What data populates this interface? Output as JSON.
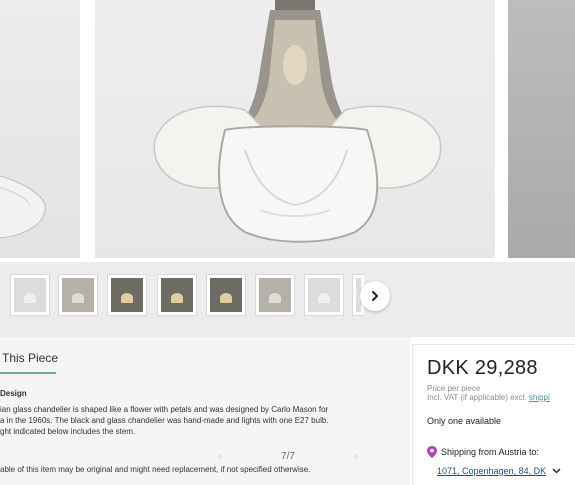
{
  "gallery": {
    "next_icon": "chevron-right-icon",
    "thumb_count": 7,
    "pager": {
      "current": "7",
      "separator": "/",
      "total": "7",
      "prev_icon": "chevron-left-icon",
      "next_icon": "chevron-right-icon"
    }
  },
  "description": {
    "tab_title": "This Piece",
    "heading": "Design",
    "lines": [
      "ian glass chandelier is shaped like a flower with petals and was designed by Carlo Mason for",
      "a in the 1960s. The black and glass chandelier was hand-made and lights with one E27 bulb.",
      "ght indicated below includes the stem."
    ],
    "footnote": "able of this item may be original and might need replacement, if not specified otherwise."
  },
  "price_panel": {
    "price": "DKK 29,288",
    "price_label": "Price per piece",
    "vat_text": "Incl. VAT (if applicable) excl. ",
    "vat_link": "shippi",
    "availability": "Only one available",
    "shipping_label": "Shipping from Austria to:",
    "location": "1071, Copenhagen, 84, DK",
    "accent": "#b040b5"
  }
}
